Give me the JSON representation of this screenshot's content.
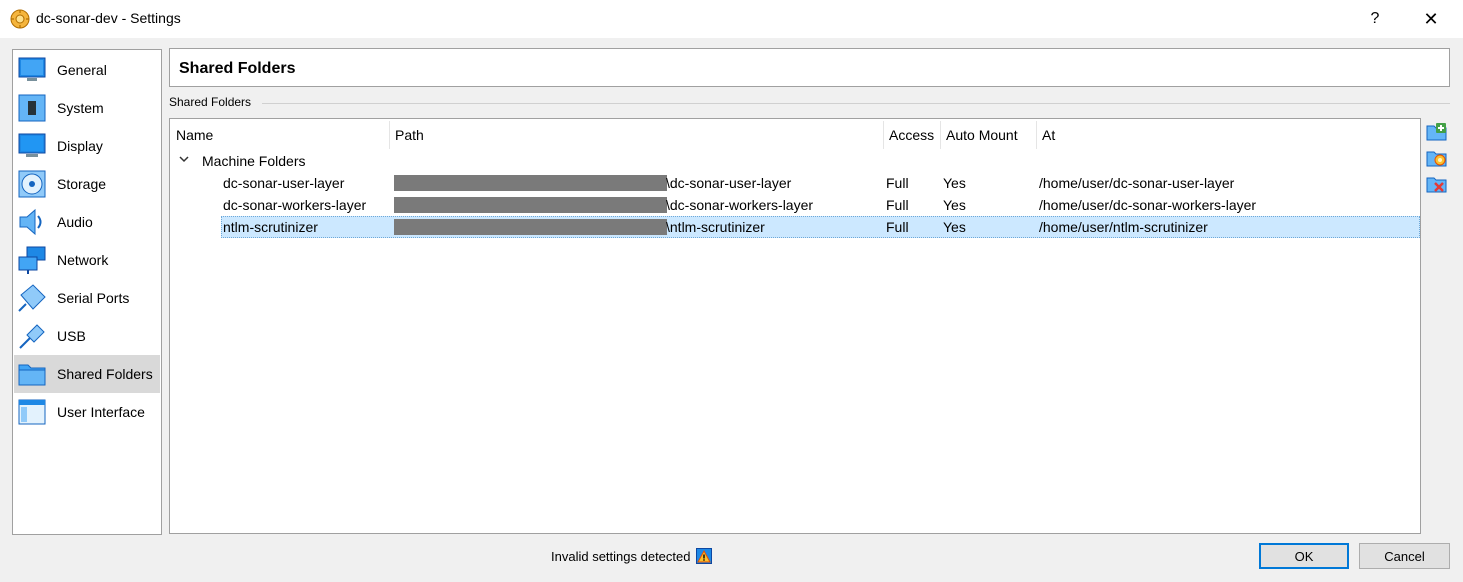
{
  "window": {
    "title": "dc-sonar-dev - Settings",
    "help_label": "?",
    "close_label": "✕"
  },
  "sidebar": {
    "items": [
      {
        "label": "General",
        "icon": "monitor-icon"
      },
      {
        "label": "System",
        "icon": "chip-icon"
      },
      {
        "label": "Display",
        "icon": "display-icon"
      },
      {
        "label": "Storage",
        "icon": "storage-disc-icon"
      },
      {
        "label": "Audio",
        "icon": "speaker-icon"
      },
      {
        "label": "Network",
        "icon": "network-icon"
      },
      {
        "label": "Serial Ports",
        "icon": "serial-port-icon"
      },
      {
        "label": "USB",
        "icon": "usb-icon"
      },
      {
        "label": "Shared Folders",
        "icon": "folder-icon"
      },
      {
        "label": "User Interface",
        "icon": "window-icon"
      }
    ],
    "selected": "Shared Folders"
  },
  "header": {
    "title": "Shared Folders"
  },
  "group": {
    "label": "Shared Folders"
  },
  "table": {
    "columns": [
      "Name",
      "Path",
      "Access",
      "Auto Mount",
      "At"
    ],
    "group_row": "Machine Folders",
    "rows": [
      {
        "name": "dc-sonar-user-layer",
        "path_suffix": "\\dc-sonar-user-layer",
        "access": "Full",
        "auto_mount": "Yes",
        "at": "/home/user/dc-sonar-user-layer"
      },
      {
        "name": "dc-sonar-workers-layer",
        "path_suffix": "\\dc-sonar-workers-layer",
        "access": "Full",
        "auto_mount": "Yes",
        "at": "/home/user/dc-sonar-workers-layer"
      },
      {
        "name": "ntlm-scrutinizer",
        "path_suffix": "\\ntlm-scrutinizer",
        "access": "Full",
        "auto_mount": "Yes",
        "at": "/home/user/ntlm-scrutinizer"
      }
    ],
    "selected_row": "ntlm-scrutinizer"
  },
  "toolbar": {
    "add_icon": "add-folder-icon",
    "edit_icon": "edit-folder-icon",
    "remove_icon": "remove-folder-icon"
  },
  "status": {
    "text": "Invalid settings detected"
  },
  "buttons": {
    "ok": "OK",
    "cancel": "Cancel"
  },
  "colors": {
    "selection": "#cce8ff",
    "accent": "#0078d7"
  }
}
